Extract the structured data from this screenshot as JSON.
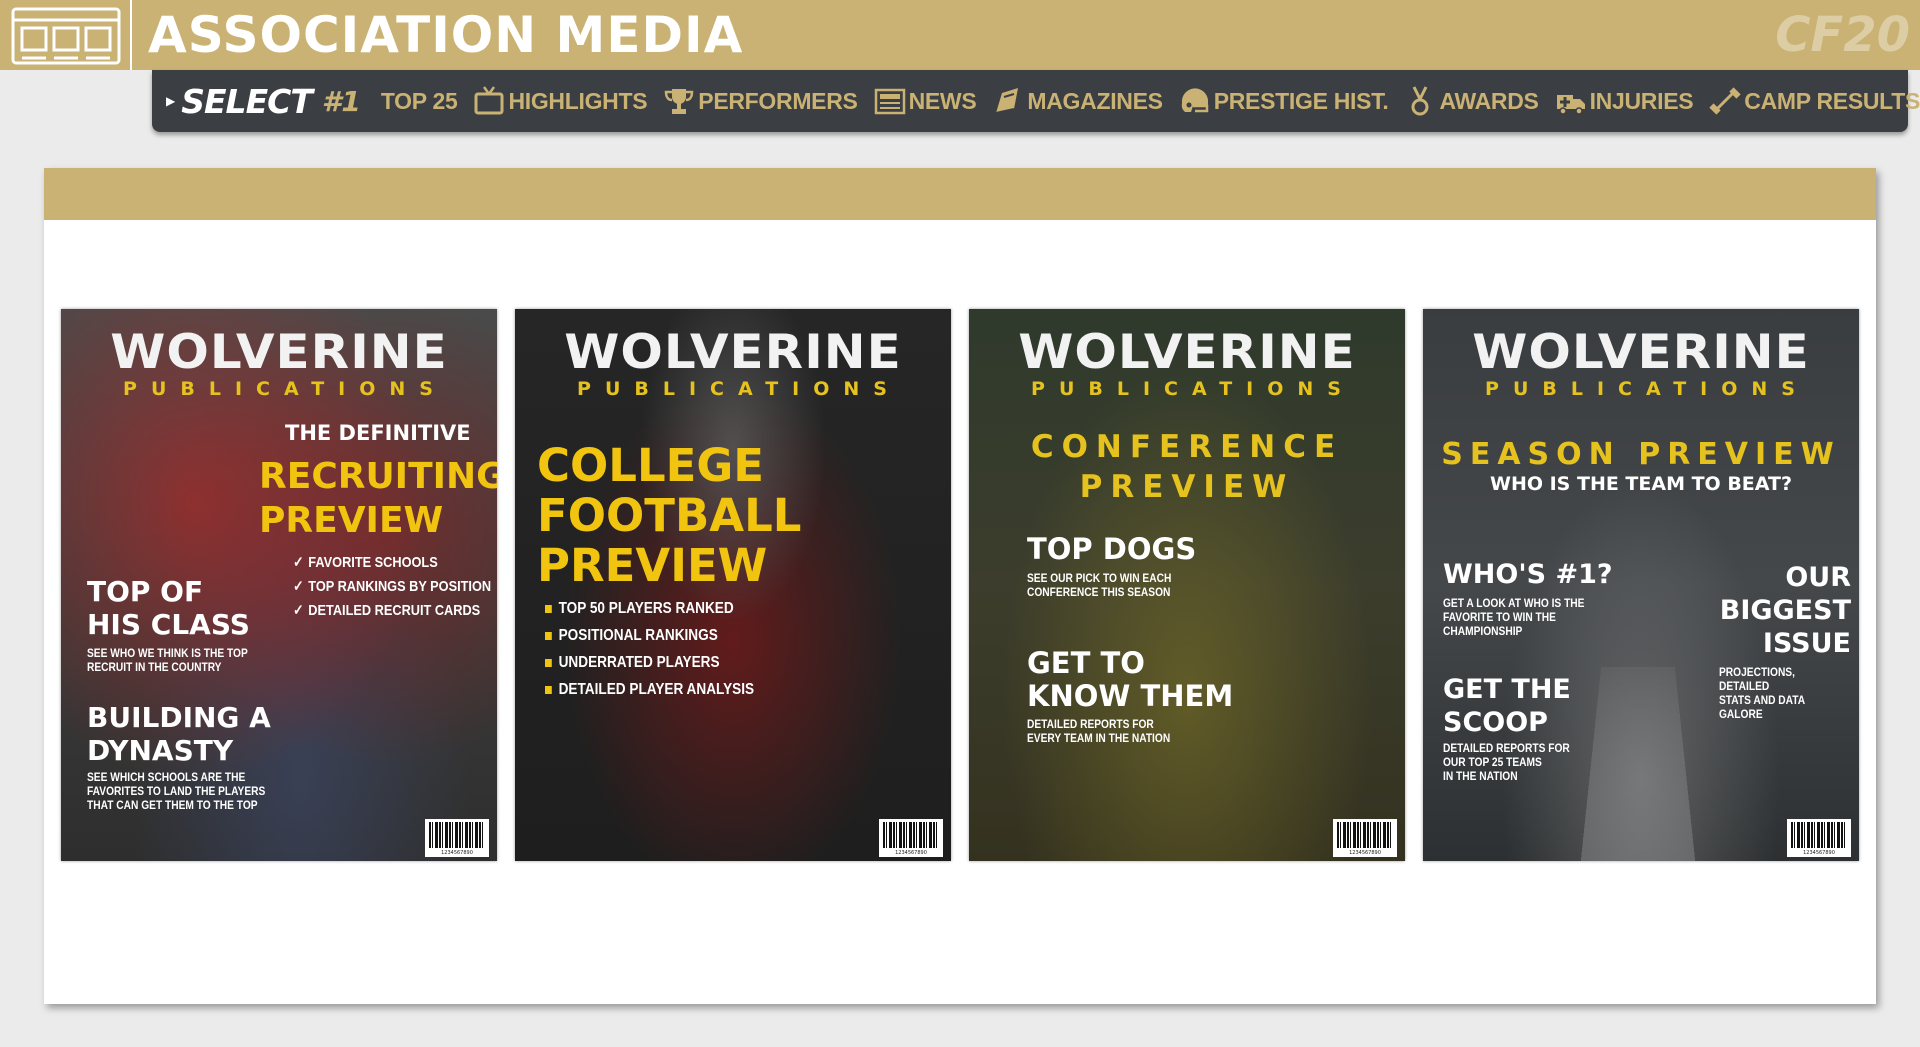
{
  "header": {
    "title": "ASSOCIATION MEDIA",
    "watermark": "CF20"
  },
  "nav": {
    "select_label": "SELECT",
    "hash_label": "#1",
    "items": [
      {
        "label": "TOP 25",
        "icon": "none"
      },
      {
        "label": "HIGHLIGHTS",
        "icon": "tv-icon"
      },
      {
        "label": "PERFORMERS",
        "icon": "trophy-icon"
      },
      {
        "label": "NEWS",
        "icon": "newspaper-icon"
      },
      {
        "label": "MAGAZINES",
        "icon": "magazine-icon"
      },
      {
        "label": "PRESTIGE HIST.",
        "icon": "helmet-icon"
      },
      {
        "label": "AWARDS",
        "icon": "medal-icon"
      },
      {
        "label": "INJURIES",
        "icon": "ambulance-icon"
      },
      {
        "label": "CAMP RESULTS",
        "icon": "dumbbell-icon"
      }
    ]
  },
  "magazines": [
    {
      "brand": "WOLVERINE",
      "brand_sub": "PUBLICATIONS",
      "kicker": "THE DEFINITIVE",
      "headline": [
        "RECRUITING",
        "PREVIEW"
      ],
      "checklist": [
        "FAVORITE SCHOOLS",
        "TOP RANKINGS BY POSITION",
        "DETAILED RECRUIT CARDS"
      ],
      "story1_title": [
        "TOP OF",
        "HIS CLASS"
      ],
      "story1_text": [
        "SEE WHO WE THINK IS THE TOP",
        "RECRUIT IN THE COUNTRY"
      ],
      "story2_title": [
        "BUILDING A",
        "DYNASTY"
      ],
      "story2_text": [
        "SEE WHICH SCHOOLS ARE THE",
        "FAVORITES TO LAND THE PLAYERS",
        "THAT CAN GET THEM TO THE TOP"
      ]
    },
    {
      "brand": "WOLVERINE",
      "brand_sub": "PUBLICATIONS",
      "headline": [
        "COLLEGE",
        "FOOTBALL",
        "PREVIEW"
      ],
      "bullets": [
        "TOP 50 PLAYERS RANKED",
        "POSITIONAL RANKINGS",
        "UNDERRATED PLAYERS",
        "DETAILED PLAYER ANALYSIS"
      ]
    },
    {
      "brand": "WOLVERINE",
      "brand_sub": "PUBLICATIONS",
      "headline": [
        "CONFERENCE",
        "PREVIEW"
      ],
      "story1_title": "TOP DOGS",
      "story1_text": [
        "SEE OUR PICK TO WIN EACH",
        "CONFERENCE THIS SEASON"
      ],
      "story2_title": [
        "GET TO",
        "KNOW THEM"
      ],
      "story2_text": [
        "DETAILED REPORTS FOR",
        "EVERY TEAM IN THE NATION"
      ]
    },
    {
      "brand": "WOLVERINE",
      "brand_sub": "PUBLICATIONS",
      "headline": "SEASON PREVIEW",
      "subhead": "WHO IS THE TEAM TO BEAT?",
      "story1_title": "WHO'S #1?",
      "story1_text": [
        "GET A LOOK AT WHO IS THE",
        "FAVORITE TO WIN THE",
        "CHAMPIONSHIP"
      ],
      "story2_title": [
        "GET THE",
        "SCOOP"
      ],
      "story2_text": [
        "DETAILED REPORTS FOR",
        "OUR TOP 25 TEAMS",
        "IN THE NATION"
      ],
      "story3_title": [
        "OUR",
        "BIGGEST",
        "ISSUE"
      ],
      "story3_text": [
        "PROJECTIONS, DETAILED",
        "STATS AND DATA GALORE"
      ]
    }
  ],
  "barcode_number": "1234567890",
  "colors": {
    "gold": "#c9b274",
    "nav_bg": "#3b3e42",
    "cover_yellow": "#f1c40f"
  }
}
